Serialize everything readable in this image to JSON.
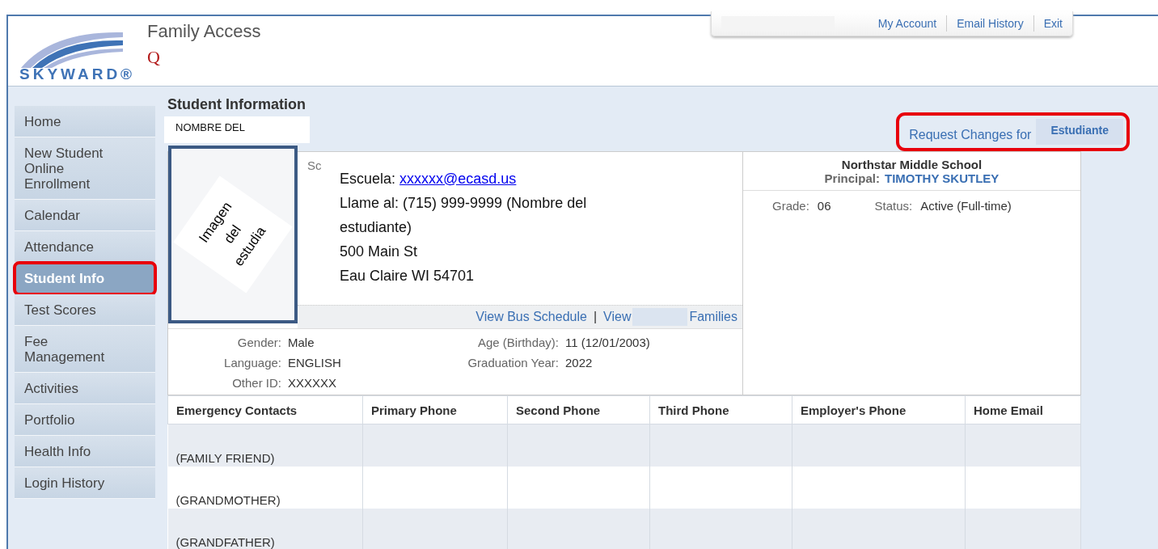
{
  "header": {
    "logo": "SKYWARD®",
    "app_title": "Family Access",
    "mark": "Q",
    "links": [
      "My Account",
      "Email History",
      "Exit"
    ]
  },
  "sidebar": {
    "items": [
      {
        "label": "Home",
        "selected": false,
        "highlighted": false
      },
      {
        "label": "New Student Online Enrollment",
        "selected": false,
        "highlighted": false
      },
      {
        "label": "Calendar",
        "selected": false,
        "highlighted": false
      },
      {
        "label": "Attendance",
        "selected": false,
        "highlighted": false
      },
      {
        "label": "Student Info",
        "selected": true,
        "highlighted": true
      },
      {
        "label": "Test Scores",
        "selected": false,
        "highlighted": false
      },
      {
        "label": "Fee Management",
        "selected": false,
        "highlighted": false
      },
      {
        "label": "Activities",
        "selected": false,
        "highlighted": false
      },
      {
        "label": "Portfolio",
        "selected": false,
        "highlighted": false
      },
      {
        "label": "Health Info",
        "selected": false,
        "highlighted": false
      },
      {
        "label": "Login History",
        "selected": false,
        "highlighted": false
      }
    ]
  },
  "page_title": "Student Information",
  "tabs": [
    {
      "label": "NOMBRE DEL"
    }
  ],
  "request_changes": {
    "label": "Request Changes for",
    "name": "Estudiante",
    "highlighted": true
  },
  "student": {
    "photo_caption": [
      "Imagen",
      "del",
      "estudia"
    ],
    "label_cut": "Sc",
    "email_label": "Escuela:",
    "email": "xxxxxx@ecasd.us",
    "address_lines": [
      "Llame al: (715) 999-9999 (Nombre del estudiante)",
      "500 Main St",
      "Eau Claire WI 54701"
    ],
    "links": [
      "View Bus Schedule",
      "View",
      "Families"
    ],
    "link_separator": "|",
    "details_left": [
      {
        "label": "Gender:",
        "value": "Male"
      },
      {
        "label": "Language:",
        "value": "ENGLISH"
      },
      {
        "label": "Other ID:",
        "value": "XXXXXX"
      }
    ],
    "details_right": [
      {
        "label": "Age (Birthday):",
        "value": "11 (12/01/2003)"
      },
      {
        "label": "Graduation Year:",
        "value": "2022"
      }
    ]
  },
  "school": {
    "name": "Northstar Middle School",
    "principal_label": "Principal:",
    "principal": "TIMOTHY SKUTLEY",
    "grade_label": "Grade:",
    "grade": "06",
    "status_label": "Status:",
    "status": "Active (Full-time)"
  },
  "contacts": {
    "columns": [
      "Emergency Contacts",
      "Primary Phone",
      "Second Phone",
      "Third Phone",
      "Employer's Phone",
      "Home Email"
    ],
    "rows": [
      [
        "(FAMILY FRIEND)"
      ],
      [
        "(GRANDMOTHER)"
      ],
      [
        "(GRANDFATHER)"
      ]
    ]
  }
}
